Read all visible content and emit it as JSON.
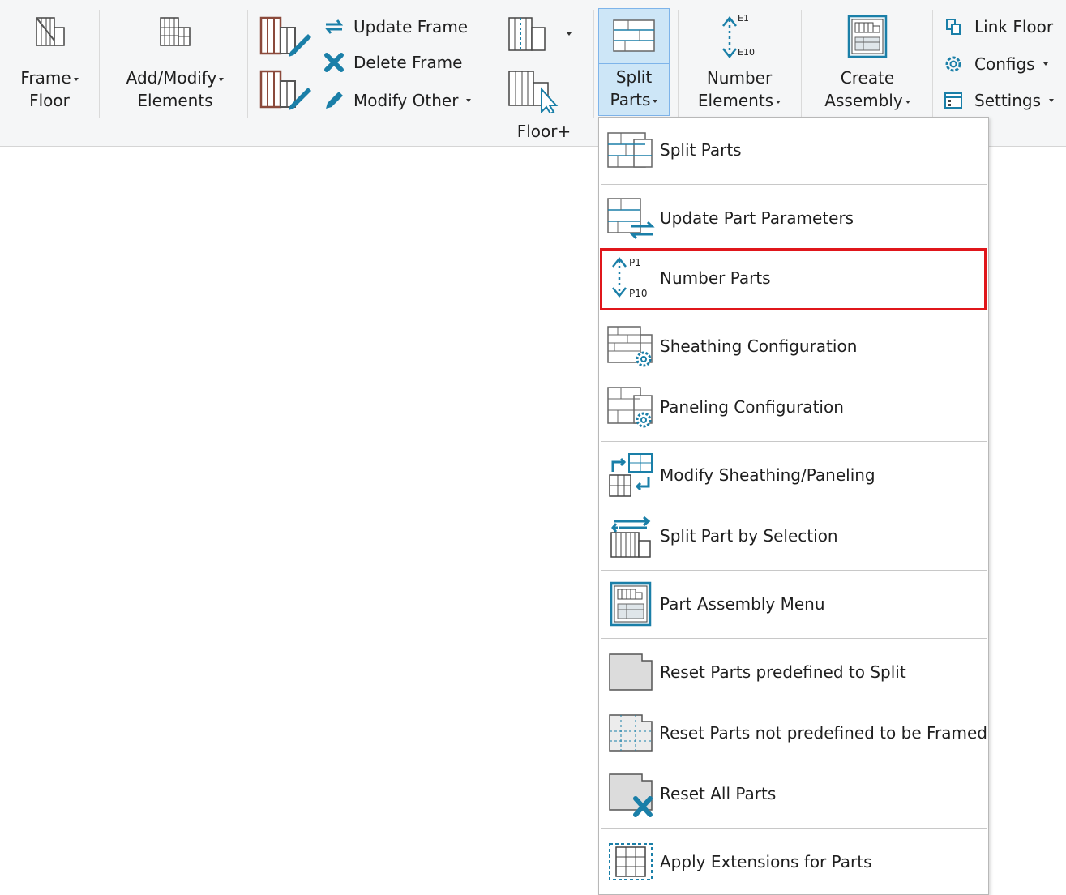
{
  "ribbon": {
    "frame_floor": {
      "line1": "Frame",
      "line2": "Floor"
    },
    "add_modify": {
      "line1": "Add/Modify",
      "line2": "Elements"
    },
    "update_frame": "Update Frame",
    "delete_frame": "Delete Frame",
    "modify_other": "Modify Other",
    "group_label": "Floor+",
    "split_parts": {
      "line1": "Split",
      "line2": "Parts"
    },
    "number_elements": {
      "line1": "Number",
      "line2": "Elements",
      "badge_top": "E1",
      "badge_bottom": "E10"
    },
    "create_assembly": {
      "line1": "Create",
      "line2": "Assembly"
    },
    "link_floor": "Link Floor",
    "configs": "Configs",
    "settings": "Settings"
  },
  "menu": {
    "items": [
      {
        "label": "Split Parts",
        "icon": "split-parts-icon"
      },
      {
        "label": "Update Part Parameters",
        "icon": "update-part-parameters-icon"
      },
      {
        "label": "Number Parts",
        "icon": "number-parts-icon",
        "badge_top": "P1",
        "badge_bottom": "P10",
        "highlighted": true
      },
      {
        "label": "Sheathing Configuration",
        "icon": "sheathing-configuration-icon"
      },
      {
        "label": "Paneling Configuration",
        "icon": "paneling-configuration-icon"
      },
      {
        "label": "Modify Sheathing/Paneling",
        "icon": "modify-sheathing-paneling-icon"
      },
      {
        "label": "Split Part by Selection",
        "icon": "split-part-by-selection-icon"
      },
      {
        "label": "Part Assembly Menu",
        "icon": "part-assembly-menu-icon"
      },
      {
        "label": "Reset Parts predefined to Split",
        "icon": "reset-parts-predefined-icon"
      },
      {
        "label": "Reset Parts not predefined to be Framed",
        "icon": "reset-parts-not-predefined-icon"
      },
      {
        "label": "Reset All Parts",
        "icon": "reset-all-parts-icon"
      },
      {
        "label": "Apply Extensions for Parts",
        "icon": "apply-extensions-icon"
      }
    ]
  },
  "colors": {
    "accent": "#1a8fb0",
    "highlight_border": "#e0161b",
    "active_button": "#cde6f7",
    "frame_brown": "#8b4a3c"
  }
}
